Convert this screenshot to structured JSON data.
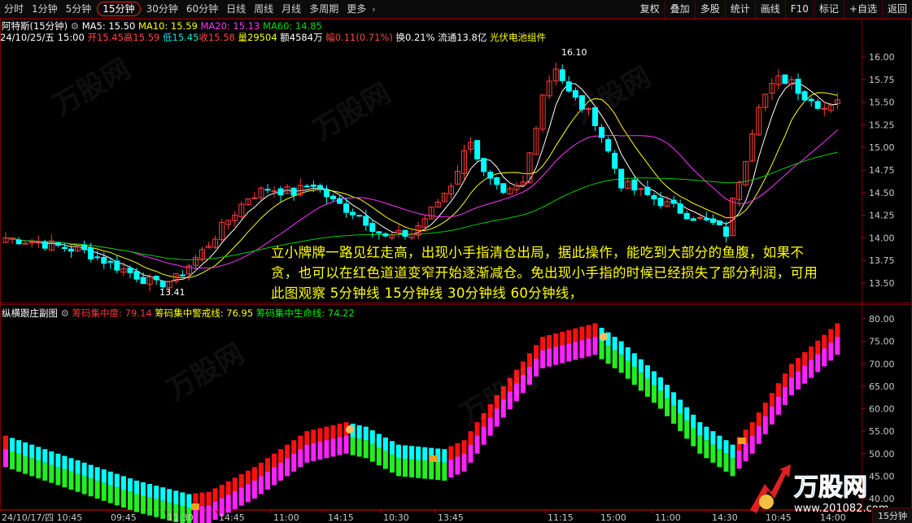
{
  "toolbar": {
    "tabs": [
      "分时",
      "1分钟",
      "5分钟",
      "15分钟",
      "30分钟",
      "60分钟",
      "日线",
      "周线",
      "月线",
      "多周期",
      "更多"
    ],
    "active_tab": "15分钟",
    "more_arrow": "›",
    "right_buttons": [
      "复权",
      "叠加",
      "多股",
      "统计",
      "画线",
      "F10",
      "标记",
      "+自选",
      "返回"
    ]
  },
  "stock": {
    "name": "阿特斯",
    "period": "(15分钟)",
    "ma5_label": "MA5: 15.50",
    "ma10_label": "MA10: 15.59",
    "ma20_label": "MA20: 15.13",
    "ma60_label": "MA60: 14.85",
    "datetime": "24/10/25/五 15:00",
    "open": "开15.45",
    "high": "高15.59",
    "low": "低15.45",
    "close": "收15.58",
    "volume": "量29504",
    "amount": "额4584万",
    "change": "幅0.11(0.71%)",
    "turnover": "换0.21%",
    "float_cap": "流通13.8亿",
    "sector": "光伏电池组件"
  },
  "main_chart": {
    "y_ticks": [
      "16.00",
      "15.75",
      "15.50",
      "15.25",
      "15.00",
      "14.75",
      "14.50",
      "14.25",
      "14.00",
      "13.75",
      "13.50"
    ],
    "high_label": "16.10",
    "low_label": "13.41"
  },
  "annotation": "立小牌牌一路见红走高，出现小手指清仓出局，据此操作，能吃到大部分的鱼腹，如果不贪，也可以在红色道道变窄开始逐渐减仓。免出现小手指的时候已经损失了部分利润，可用此图观察 5分钟线 15分钟线 30分钟线 60分钟线，",
  "sub_chart": {
    "title": "纵横跟庄副图",
    "line1": "筹码集中度: 79.14",
    "line2": "筹码集中警戒线: 76.95",
    "line3": "筹码集中生命线: 74.22",
    "y_ticks": [
      "80.00",
      "75.00",
      "70.00",
      "65.00",
      "60.00",
      "55.00",
      "50.00",
      "45.00",
      "40.00"
    ]
  },
  "time_axis": {
    "start_label": "24/10/17/四 10:45",
    "labels": [
      "09:45",
      "11:30",
      "14:45",
      "11:00",
      "14:15",
      "10:30",
      "13:45",
      "11:15",
      "15:00",
      "11:00",
      "14:30",
      "10:45",
      "14:00"
    ]
  },
  "corner_label": "15分钟",
  "logo": {
    "brand": "万股网",
    "url": "www.201082.com"
  },
  "colors": {
    "up": "#ff3b3b",
    "down": "#00ffff",
    "ma5": "#ffffff",
    "ma10": "#ffff00",
    "ma20": "#ff33ff",
    "ma60": "#00cc00",
    "accent_border": "#7a0000"
  }
}
